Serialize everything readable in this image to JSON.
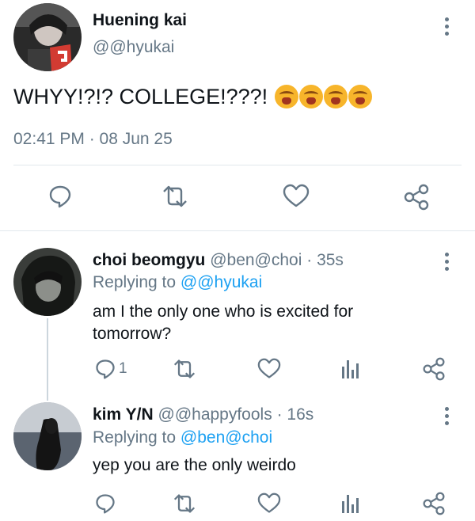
{
  "main_tweet": {
    "name": "Huening kai",
    "handle": "@@hyukai",
    "text": "WHYY!?!? COLLEGE!???!",
    "emoji": [
      "loudly-crying-face",
      "loudly-crying-face",
      "loudly-crying-face",
      "loudly-crying-face"
    ],
    "timestamp": "02:41 PM · 08 Jun 25"
  },
  "replies": [
    {
      "name": "choi beomgyu",
      "handle": "@ben@choi",
      "time": "· 35s",
      "replying_prefix": "Replying to",
      "replying_to": "@@hyukai",
      "text": "am I the only one who is excited for tomorrow?",
      "reply_count": "1"
    },
    {
      "name": "kim Y/N",
      "handle": "@@happyfools",
      "time": "· 16s",
      "replying_prefix": "Replying to",
      "replying_to": "@ben@choi",
      "text": "yep you are the only weirdo",
      "reply_count": ""
    }
  ],
  "colors": {
    "accent": "#1da1f2",
    "secondary_text": "#657786",
    "divider": "#e1e8ed"
  },
  "icons": [
    "reply-icon",
    "retweet-icon",
    "like-icon",
    "share-icon",
    "analytics-icon",
    "more-options-icon"
  ]
}
